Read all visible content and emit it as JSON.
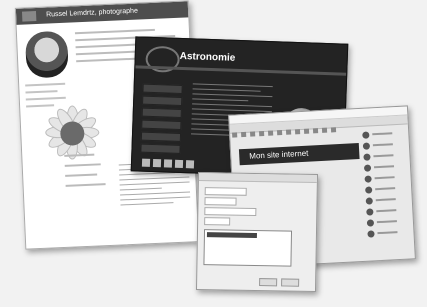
{
  "windows": {
    "photo": {
      "header": "Russel Lemdrtz, photographe"
    },
    "astro": {
      "title": "Astronomie"
    },
    "editor": {
      "banner": "Mon site internet"
    }
  }
}
